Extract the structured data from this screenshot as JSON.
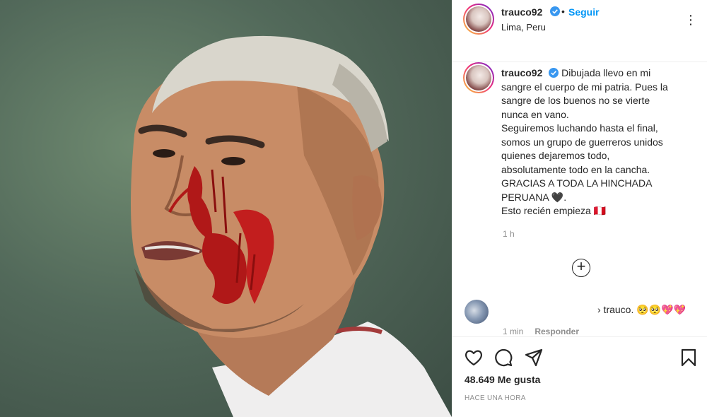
{
  "post": {
    "username": "trauco92",
    "follow_label": "Seguir",
    "separator": "•",
    "location": "Lima, Peru",
    "more_label": "⋮",
    "verified": true
  },
  "caption": {
    "username": "trauco92",
    "lines": [
      "Dibujada llevo en mi",
      "sangre el cuerpo de mi patria. Pues la",
      "sangre de los buenos no se vierte",
      "nunca en vano.",
      "Seguiremos luchando hasta el final,",
      "somos un grupo de guerreros unidos",
      "quienes dejaremos todo,",
      "absolutamente todo en la cancha.",
      "GRACIAS A TODA LA HINCHADA",
      "PERUANA 🖤.",
      "Esto recién empieza 🇵🇪"
    ],
    "time": "1 h",
    "load_more_label": "+"
  },
  "comment": {
    "text": "› trauco. 🥺🥺💖💖",
    "time": "1 min",
    "reply_label": "Responder"
  },
  "actions": {
    "icons": [
      "heart-icon",
      "comment-icon",
      "share-icon",
      "bookmark-icon"
    ],
    "likes_count": "48.649",
    "likes_label": "Me gusta",
    "posted_label": "HACE UNA HORA"
  },
  "colors": {
    "accent": "#0095f6",
    "text": "#262626",
    "muted": "#8e8e8e",
    "border": "#efefef",
    "verified": "#3897f0"
  }
}
